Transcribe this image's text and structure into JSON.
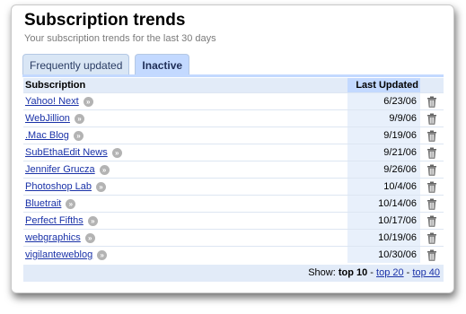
{
  "widget": {
    "title": "Subscription trends",
    "subtitle": "Your subscription trends for the last 30 days"
  },
  "tabs": [
    {
      "label": "Frequently updated",
      "active": false
    },
    {
      "label": "Inactive",
      "active": true
    }
  ],
  "table": {
    "headers": {
      "subscription": "Subscription",
      "last_updated": "Last Updated"
    },
    "rows": [
      {
        "name": "Yahoo! Next",
        "date": "6/23/06"
      },
      {
        "name": "WebJillion",
        "date": "9/9/06"
      },
      {
        "name": ".Mac Blog",
        "date": "9/19/06"
      },
      {
        "name": "SubEthaEdit News",
        "date": "9/21/06"
      },
      {
        "name": "Jennifer Grucza",
        "date": "9/26/06"
      },
      {
        "name": "Photoshop Lab",
        "date": "10/4/06"
      },
      {
        "name": "Bluetrait",
        "date": "10/14/06"
      },
      {
        "name": "Perfect Fifths",
        "date": "10/17/06"
      },
      {
        "name": "webgraphics",
        "date": "10/19/06"
      },
      {
        "name": "vigilanteweblog",
        "date": "10/30/06"
      }
    ]
  },
  "footer": {
    "show_label": "Show:",
    "current": "top 10",
    "sep1": " - ",
    "option2": "top 20",
    "sep2": " - ",
    "option3": "top 40"
  },
  "icons": {
    "row_action": "go-arrow-icon",
    "delete": "trash-icon"
  },
  "colors": {
    "tab_active": "#c3d9ff",
    "header_bg": "#e2ebf8",
    "link": "#1a32a8"
  }
}
